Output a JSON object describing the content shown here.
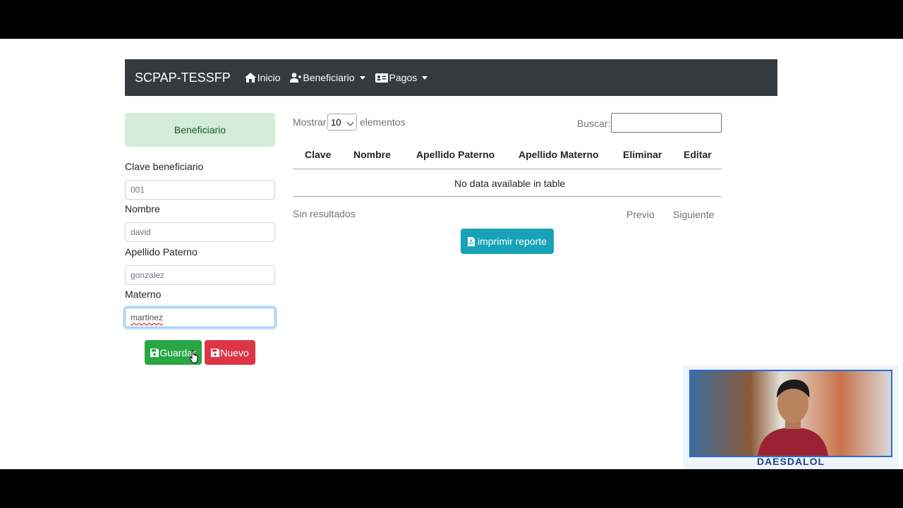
{
  "navbar": {
    "brand": "SCPAP-TESSFP",
    "items": [
      {
        "label": "Inicio",
        "icon": "home-icon"
      },
      {
        "label": "Beneficiario",
        "icon": "user-plus-icon"
      },
      {
        "label": "Pagos",
        "icon": "id-card-icon"
      }
    ]
  },
  "form": {
    "header": "Beneficiario",
    "fields": [
      {
        "label": "Clave beneficiario",
        "value": "001"
      },
      {
        "label": "Nombre",
        "value": "david"
      },
      {
        "label": "Apellido Paterno",
        "value": "gonzalez"
      },
      {
        "label": "Materno",
        "value": "martinez"
      }
    ],
    "save_label": "Guardar",
    "new_label": "Nuevo"
  },
  "table": {
    "length_prefix": "Mostrar",
    "length_value": "10",
    "length_suffix": "elementos",
    "search_label": "Buscar:",
    "search_value": "",
    "columns": [
      "Clave",
      "Nombre",
      "Apellido Paterno",
      "Apellido Materno",
      "Eliminar",
      "Editar"
    ],
    "empty_text": "No data available in table",
    "info": "Sin resultados",
    "prev_label": "Previo",
    "next_label": "Siguiente",
    "report_label": "imprimir reporte"
  },
  "webcam": {
    "label": "DAESDALOL"
  },
  "colors": {
    "navbar": "#343a40",
    "success": "#28a745",
    "danger": "#dc3545",
    "info": "#17a2b8",
    "alert_success_bg": "#d4edda"
  }
}
